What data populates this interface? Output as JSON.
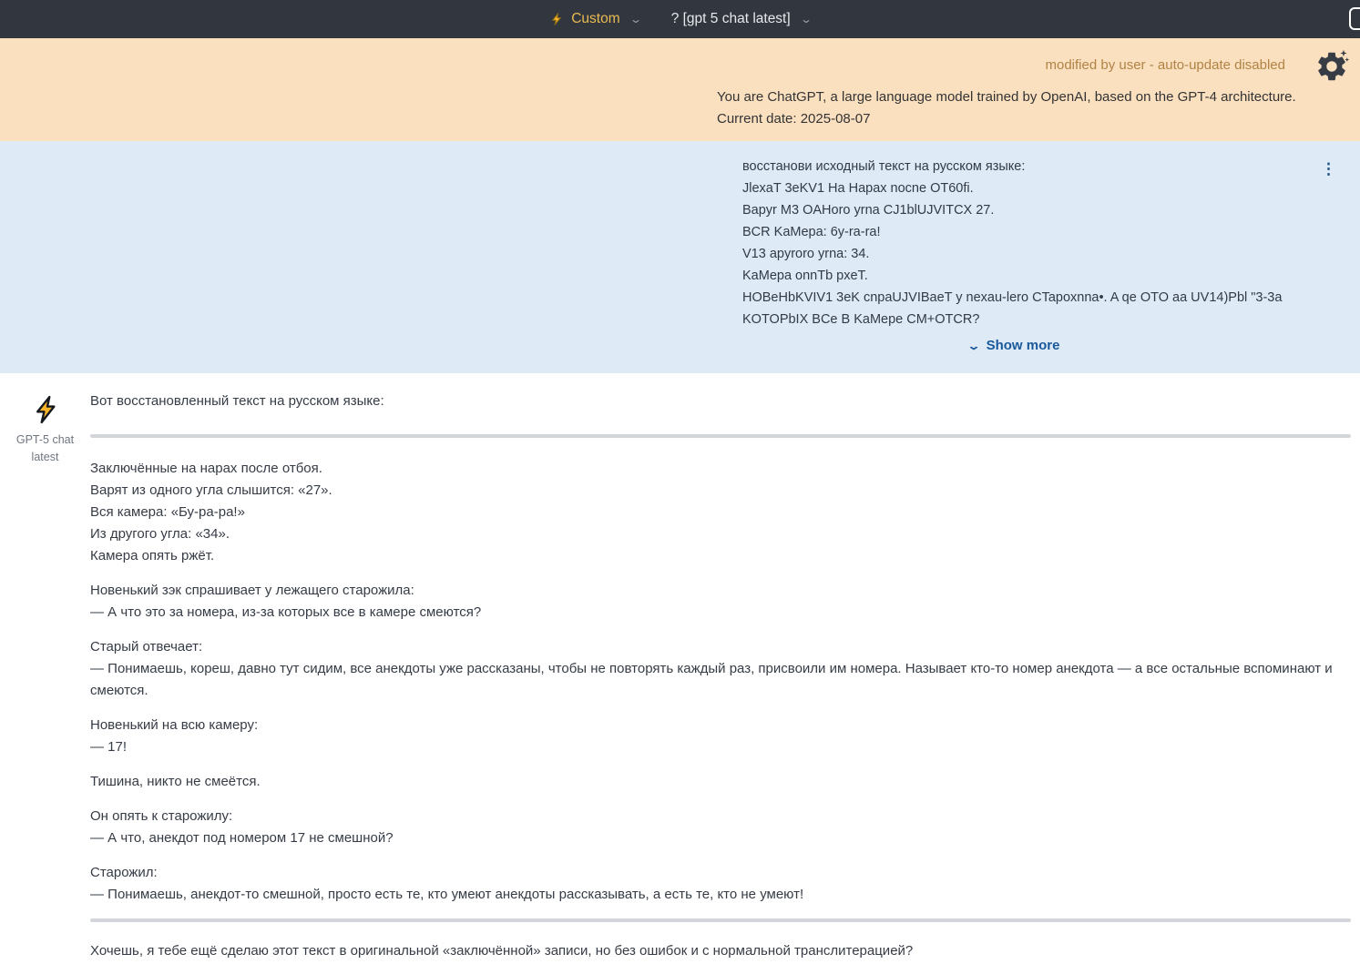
{
  "topbar": {
    "mode": {
      "icon": "lightning-bolt",
      "label": "Custom"
    },
    "model": {
      "label": "? [gpt 5 chat latest]"
    }
  },
  "system_message": {
    "status": "modified by user - auto-update disabled",
    "gear_icon": "gear-with-sparkles",
    "prompt": "You are ChatGPT, a large language model trained by OpenAI, based on the GPT-4 architecture.\nCurrent date: 2025-08-07"
  },
  "user_message": {
    "text": "восстанови исходный текст на русском языке:\nJlexaT 3eKV1 Ha Hapax nocne OT60fi.\nBapyr M3 OAHoro yrna CJ1blUJVITCX 27.\nBCR KaMepa: 6y-ra-ra!\nV13 apyroro yrna: 34.\nKaMepa onnTb pxeT.\nHOBeHbKVIV1 3eK cnpaUJVIBaeT y nexau-lero CTapoxnna•. A qe OTO aa UV14)Pbl \"3-3a\nKOTOPbIX BCe B KaMepe CM+OTCR?",
    "show_more_label": "Show more",
    "kebab_icon": "⋮",
    "chevron_down": "⌄"
  },
  "assistant_message": {
    "model_name": "GPT-5 chat latest",
    "avatar_icon": "lightning-bolt",
    "intro": "Вот восстановленный текст на русском языке:",
    "paragraphs": [
      "Заключённые на нарах после отбоя.\nВарят из одного угла слышится: «27».\nВся камера: «Бу-ра-ра!»\nИз другого угла: «34».\nКамера опять ржёт.",
      "Новенький зэк спрашивает у лежащего старожила:\n— А что это за номера, из-за которых все в камере смеются?",
      "Старый отвечает:\n— Понимаешь, кореш, давно тут сидим, все анекдоты уже рассказаны, чтобы не повторять каждый раз, присвоили им номера. Называет кто-то номер анекдота — а все остальные вспоминают и смеются.",
      "Новенький на всю камеру:\n— 17!",
      "Тишина, никто не смеётся.",
      "Он опять к старожилу:\n— А что, анекдот под номером 17 не смешной?",
      "Старожил:\n— Понимаешь, анекдот-то смешной, просто есть те, кто умеют анекдоты рассказывать, а есть те, кто не умеют!"
    ],
    "outro": "Хочешь, я тебе ещё сделаю этот текст в оригинальной «заключённой» записи, но без ошибок и с нормальной транслитерацией?"
  },
  "colors": {
    "topbar_bg": "#32373F",
    "system_bg": "#FBE0C0",
    "user_bg": "#DEEBF7",
    "status_amber": "#B08344",
    "mode_amber": "#E9BA52",
    "link_blue": "#19599B",
    "bolt_yellow": "#F9B42A",
    "divider_gray": "#D2D6DA"
  },
  "chevrons": {
    "down": "⌄"
  }
}
